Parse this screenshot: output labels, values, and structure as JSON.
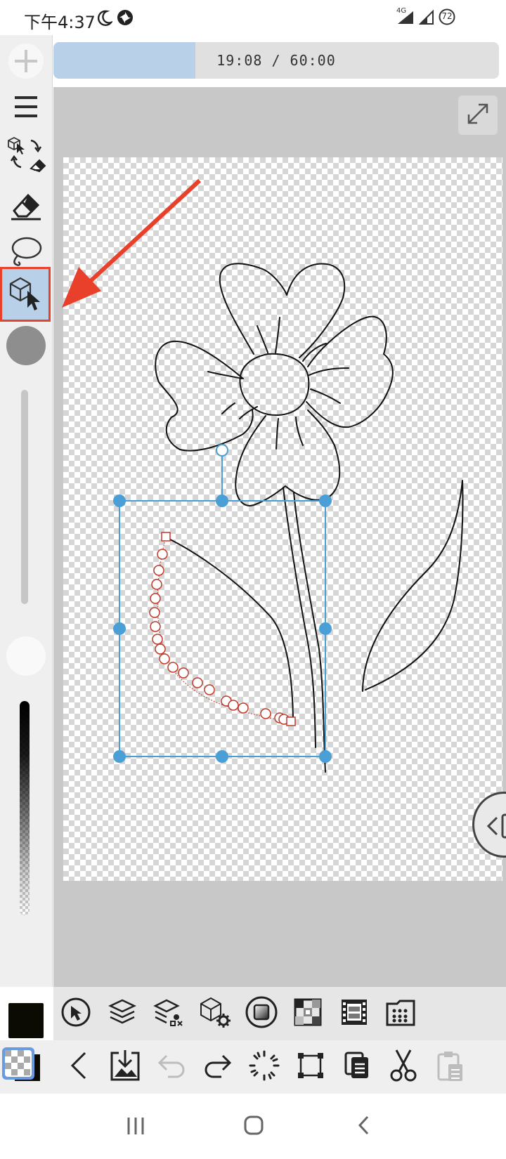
{
  "status_bar": {
    "time": "下午4:37",
    "network": "4G",
    "battery": "72"
  },
  "timer": {
    "text": "19:08 / 60:00",
    "elapsed_fraction": 0.318
  },
  "left_toolbar": {
    "tools": [
      "add-icon",
      "menu-icon",
      "tool-switch-icon",
      "eraser-icon",
      "lasso-icon",
      "transform-select-icon"
    ],
    "selected_tool": "transform-select-icon",
    "brush_size_slider": 1.0,
    "opacity_slider": 1.0
  },
  "bottom_tools": [
    "transform-icon",
    "layers-icon",
    "layer-settings-icon",
    "3d-settings-icon",
    "filter-icon",
    "grid-icon",
    "film-icon",
    "dots-grid-icon"
  ],
  "action_bar": [
    "back-icon",
    "import-icon",
    "undo-icon",
    "redo-icon",
    "select-all-icon",
    "crop-icon",
    "copy-icon",
    "cut-icon",
    "paste-icon"
  ],
  "colors": {
    "accent": "#4a9fd6",
    "selected_tool_bg": "#b8d0e8",
    "annotation": "#e8402a",
    "curve_points": "#c0392b",
    "primary_color": "#0b0b04"
  },
  "nav_bar": [
    "recent-apps-icon",
    "home-icon",
    "back-nav-icon"
  ]
}
